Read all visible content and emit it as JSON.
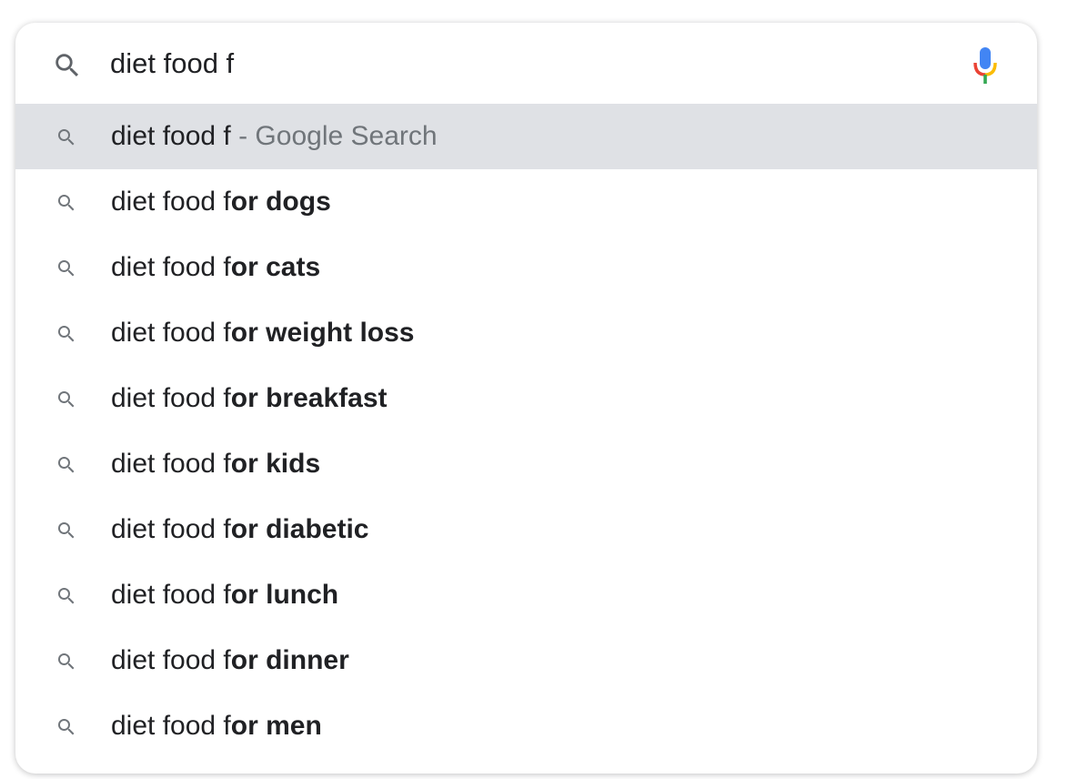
{
  "search": {
    "value": "diet food f"
  },
  "first_suggestion": {
    "query": "diet food f",
    "suffix": " - Google Search"
  },
  "suggestions": [
    {
      "typed": "diet food f",
      "completion": "or ",
      "bold": "dogs"
    },
    {
      "typed": "diet food f",
      "completion": "or ",
      "bold": "cats"
    },
    {
      "typed": "diet food f",
      "completion": "or ",
      "bold": "weight loss"
    },
    {
      "typed": "diet food f",
      "completion": "or ",
      "bold": "breakfast"
    },
    {
      "typed": "diet food f",
      "completion": "or ",
      "bold": "kids"
    },
    {
      "typed": "diet food f",
      "completion": "or ",
      "bold": "diabetic"
    },
    {
      "typed": "diet food f",
      "completion": "or ",
      "bold": "lunch"
    },
    {
      "typed": "diet food f",
      "completion": "or ",
      "bold": "dinner"
    },
    {
      "typed": "diet food f",
      "completion": "or ",
      "bold": "men"
    }
  ],
  "icons": {
    "search": "search-icon",
    "mic": "microphone-icon"
  },
  "colors": {
    "highlight": "#dfe1e5",
    "text": "#202124",
    "hint": "#70757a",
    "mic_blue": "#4285f4",
    "mic_red": "#ea4335",
    "mic_yellow": "#fbbc05",
    "mic_green": "#34a853"
  }
}
